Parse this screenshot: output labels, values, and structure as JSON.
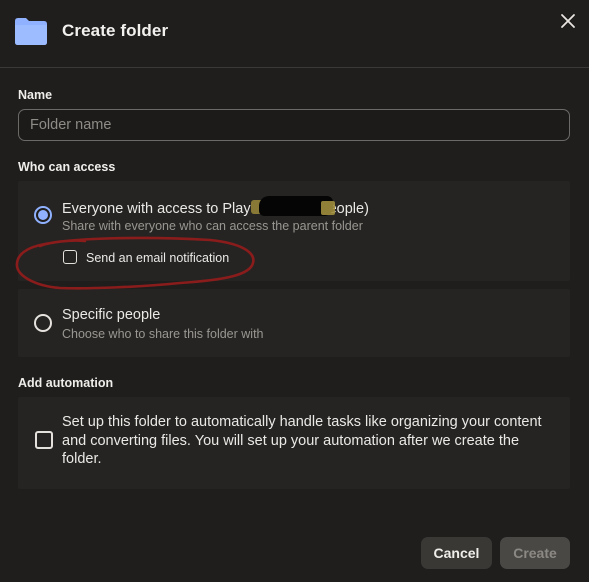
{
  "dialog": {
    "title": "Create folder",
    "folder_icon": "folder-icon",
    "close_icon": "close-icon",
    "accent_color": "#8fb1ff"
  },
  "name_section": {
    "label": "Name",
    "placeholder": "Folder name",
    "value": ""
  },
  "access_section": {
    "label": "Who can access",
    "options": [
      {
        "title": "Everyone with access to Play [redacted] people)",
        "title_visible_prefix": "Everyone with access to Play",
        "title_visible_suffix": "eople)",
        "subtitle": "Share with everyone who can access the parent folder",
        "selected": true,
        "email_notification_label": "Send an email notification",
        "email_notification_checked": false
      },
      {
        "title": "Specific people",
        "subtitle": "Choose who to share this folder with",
        "selected": false
      }
    ]
  },
  "automation_section": {
    "label": "Add automation",
    "text": "Set up this folder to automatically handle tasks like organizing your content and converting files. You will set up your automation after we create the folder.",
    "checked": false
  },
  "footer": {
    "cancel_label": "Cancel",
    "create_label": "Create"
  }
}
